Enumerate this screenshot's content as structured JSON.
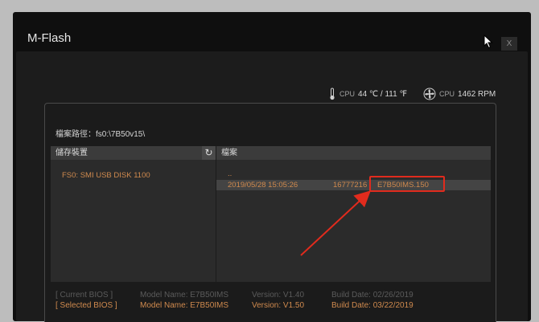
{
  "window": {
    "title": "M-Flash",
    "close_label": "X"
  },
  "status": {
    "cpu_temp_label": "CPU",
    "cpu_temp_value": "44 ℃ / 111 ℉",
    "cpu_fan_label": "CPU",
    "cpu_fan_value": "1462 RPM"
  },
  "path": {
    "text": "檔案路徑：fs0:\\7B50v15\\"
  },
  "storage": {
    "header": "儲存裝置",
    "refresh_glyph": "↻",
    "device": "FS0: SMI USB DISK 1100"
  },
  "files": {
    "header": "檔案",
    "parent": "..",
    "rows": [
      {
        "date": "2019/05/28 15:05:26",
        "size": "16777216",
        "name": "E7B50IMS.150"
      }
    ]
  },
  "bios": {
    "current": {
      "label": "[ Current BIOS   ]",
      "model": "Model Name: E7B50IMS",
      "version": "Version: V1.40",
      "date": "Build Date: 02/26/2019"
    },
    "selected": {
      "label": "[ Selected BIOS ]",
      "model": "Model Name: E7B50IMS",
      "version": "Version: V1.50",
      "date": "Build Date: 03/22/2019"
    }
  },
  "colors": {
    "accent": "#d08a4e",
    "highlight": "#e12b1d"
  },
  "icons": [
    "thermometer-icon",
    "fan-icon",
    "refresh-icon",
    "close-icon",
    "mouse-cursor-icon"
  ]
}
